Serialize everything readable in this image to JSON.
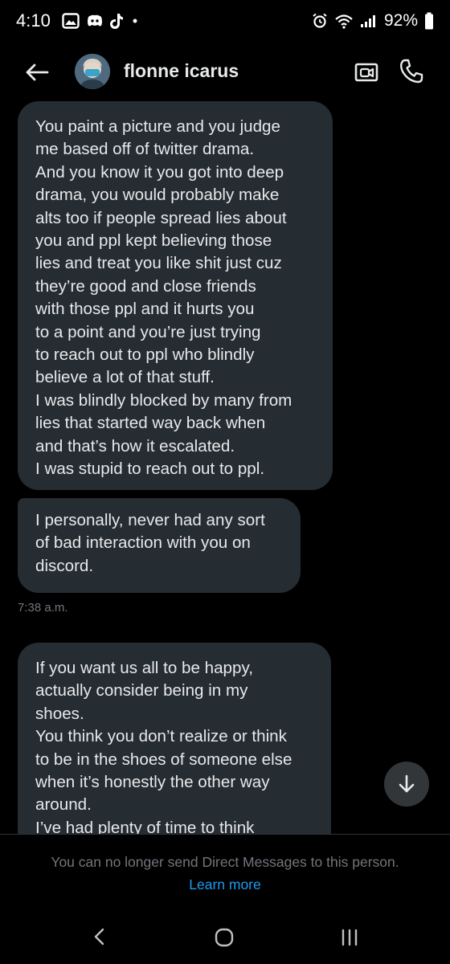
{
  "status_bar": {
    "time": "4:10",
    "battery": "92%",
    "left_icons": [
      "gallery-icon",
      "discord-icon",
      "tiktok-icon"
    ],
    "right_icons": [
      "alarm-icon",
      "wifi-icon",
      "signal-icon",
      "battery-icon"
    ],
    "dot": "•"
  },
  "header": {
    "contact_name": "flonne icarus",
    "icons": [
      "back-arrow-icon",
      "video-call-icon",
      "phone-icon"
    ]
  },
  "messages": [
    {
      "text": "You paint a picture and you judge\nme based off of twitter drama.\nAnd you know it you got into deep\ndrama, you would probably make\nalts too if people spread lies about\nyou and ppl kept believing those\nlies and treat you like shit just cuz\nthey’re good and close friends\nwith those ppl and it hurts you\nto a point and you’re just trying\nto reach out to ppl who blindly\nbelieve a lot of that stuff.\nI was blindly blocked by many from\nlies that started way back when\nand that’s how it escalated.\nI was stupid to reach out to ppl."
    },
    {
      "text": "I personally, never had any sort\nof bad interaction with you on\ndiscord."
    },
    {
      "text": "If you want us all to be happy,\nactually consider being in my\nshoes.\nYou think you don’t realize or think\nto be in the shoes of someone else\nwhen it’s honestly the other way\naround.\nI’ve had plenty of time to think"
    }
  ],
  "timestamp": "7:38 a.m.",
  "footer": {
    "notice": "You can no longer send Direct Messages to this person.",
    "learn_more": "Learn more"
  },
  "colors": {
    "background": "#000000",
    "bubble": "#252c32",
    "text": "#e7e9ea",
    "muted": "#71767b",
    "link": "#1d9bf0"
  }
}
